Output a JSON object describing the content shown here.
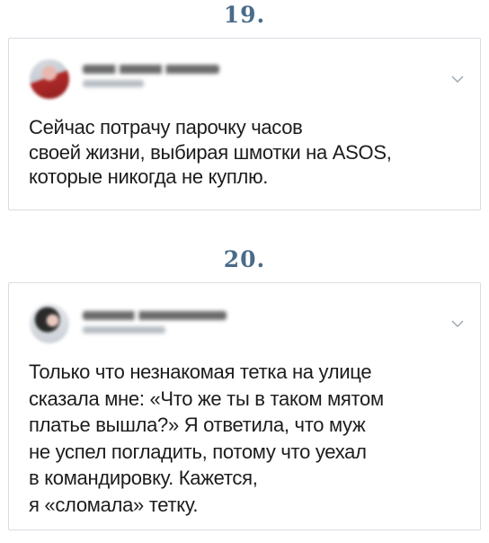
{
  "items": [
    {
      "number": "19.",
      "tweet": {
        "avatar_icon": "user-avatar-icon",
        "name_redacted": "Blurred account name",
        "handle_redacted": "Blurred account handle",
        "menu_icon": "chevron-down-icon",
        "lines": [
          "Сейчас потрачу парочку часов",
          "своей жизни, выбирая шмотки на ASOS,",
          "которые никогда не куплю."
        ]
      }
    },
    {
      "number": "20.",
      "tweet": {
        "avatar_icon": "user-avatar-icon",
        "name_redacted": "Blurred account name",
        "handle_redacted": "Blurred account handle",
        "menu_icon": "chevron-down-icon",
        "lines": [
          "Только что незнакомая тетка на улице",
          "сказала мне: «Что же ты в таком мятом",
          "платье вышла?» Я ответила, что муж",
          "не успел погладить, потому что уехал",
          "в командировку. Кажется,",
          "я «сломала» тетку."
        ]
      }
    }
  ],
  "colors": {
    "number": "#4a6b8a",
    "card_border": "#d8dde2",
    "text": "#1c1c1c",
    "chevron": "#9aa5b1"
  }
}
